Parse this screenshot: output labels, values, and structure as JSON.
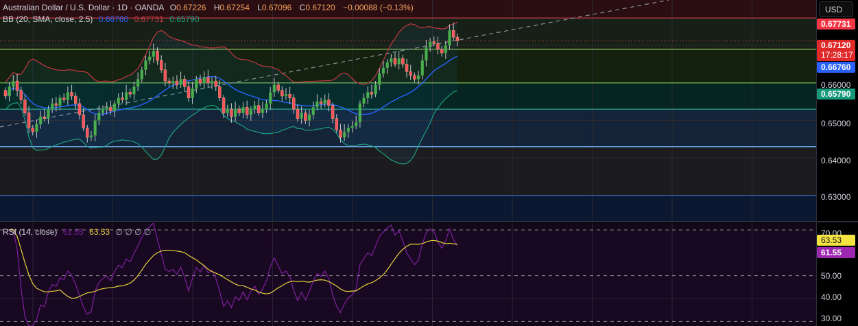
{
  "header": {
    "symbol": "Australian Dollar / U.S. Dollar · 1D · OANDA",
    "open_label": "O",
    "open": "0.67226",
    "high_label": "H",
    "high": "0.67254",
    "low_label": "L",
    "low": "0.67096",
    "close_label": "C",
    "close": "0.67120",
    "change": "−0.00088 (−0.13%)"
  },
  "bb_legend": {
    "label": "BB (20, SMA, close, 2.5)",
    "basis": "0.66760",
    "upper": "0.67731",
    "lower": "0.65790"
  },
  "rsi_legend": {
    "label": "RSI (14, close)",
    "rsi": "61.55",
    "ma": "63.53",
    "extras": "∅ ∅ ∅ ∅"
  },
  "currency_button": "USD",
  "price_axis": {
    "ticks": [
      "0.66000",
      "0.65000",
      "0.64000",
      "0.63000"
    ],
    "tags": {
      "upper": "0.67731",
      "last": "0.67120",
      "countdown": "17:28:17",
      "basis": "0.66760",
      "lower": "0.65790"
    }
  },
  "rsi_axis": {
    "ticks": [
      "70.00",
      "50.00",
      "40.00",
      "30.00"
    ],
    "tags": {
      "ma": "63.53",
      "rsi": "61.55"
    }
  },
  "colors": {
    "up": "#4caf50",
    "down": "#f7525f",
    "bb_basis": "#2962ff",
    "bb_upper": "#c2393f",
    "bb_lower": "#1f9e80",
    "rsi": "#7e1fa0",
    "rsi_ma": "#e8d33a"
  },
  "chart_data": {
    "type": "candlestick",
    "title": "Australian Dollar / U.S. Dollar · 1D · OANDA",
    "ylim": [
      0.6232,
      0.6821
    ],
    "y_ticks": [
      0.63,
      0.64,
      0.65,
      0.66
    ],
    "closes": [
      0.6565,
      0.659,
      0.6605,
      0.658,
      0.6555,
      0.652,
      0.648,
      0.647,
      0.649,
      0.651,
      0.6505,
      0.653,
      0.6545,
      0.654,
      0.656,
      0.6555,
      0.6575,
      0.6565,
      0.6545,
      0.6515,
      0.648,
      0.6455,
      0.646,
      0.65,
      0.652,
      0.653,
      0.6535,
      0.6525,
      0.6545,
      0.656,
      0.6555,
      0.6575,
      0.657,
      0.659,
      0.661,
      0.6635,
      0.666,
      0.667,
      0.6685,
      0.666,
      0.6635,
      0.6605,
      0.66,
      0.6605,
      0.6595,
      0.661,
      0.659,
      0.656,
      0.6585,
      0.661,
      0.66,
      0.6615,
      0.66,
      0.6605,
      0.659,
      0.656,
      0.652,
      0.653,
      0.651,
      0.653,
      0.652,
      0.6535,
      0.6515,
      0.653,
      0.654,
      0.652,
      0.653,
      0.6545,
      0.6575,
      0.6595,
      0.658,
      0.6565,
      0.657,
      0.656,
      0.653,
      0.6505,
      0.652,
      0.65,
      0.6515,
      0.6535,
      0.655,
      0.6545,
      0.6555,
      0.654,
      0.6505,
      0.6475,
      0.6455,
      0.647,
      0.648,
      0.6485,
      0.6495,
      0.6545,
      0.656,
      0.6575,
      0.657,
      0.6595,
      0.6625,
      0.664,
      0.6655,
      0.6665,
      0.665,
      0.6665,
      0.665,
      0.663,
      0.662,
      0.661,
      0.662,
      0.666,
      0.6695,
      0.671,
      0.6705,
      0.669,
      0.668,
      0.67,
      0.674,
      0.6722,
      0.6712
    ],
    "horizontal_levels": [
      {
        "price": 0.67731,
        "color": "#e04050"
      },
      {
        "price": 0.669,
        "color": "#9acd62"
      },
      {
        "price": 0.66,
        "color": "#7ccf5a"
      },
      {
        "price": 0.653,
        "color": "#30b59b"
      },
      {
        "price": 0.643,
        "color": "#6fb7ff"
      },
      {
        "price": 0.63,
        "color": "#3f6fc7"
      }
    ],
    "zones": [
      {
        "from": 0.6821,
        "to": 0.67731,
        "color": "#2a0e12"
      },
      {
        "from": 0.67731,
        "to": 0.669,
        "color": "#172016"
      },
      {
        "from": 0.669,
        "to": 0.66,
        "color": "#14210f"
      },
      {
        "from": 0.66,
        "to": 0.653,
        "color": "#062420"
      },
      {
        "from": 0.653,
        "to": 0.643,
        "color": "#142337"
      },
      {
        "from": 0.643,
        "to": 0.63,
        "color": "#1c1c1e"
      },
      {
        "from": 0.63,
        "to": 0.6232,
        "color": "#0c1832"
      }
    ],
    "rsi": {
      "period": 14,
      "ma_period": 14,
      "ylim": [
        28,
        73
      ],
      "levels": [
        70,
        50,
        30
      ],
      "ticks": [
        70,
        50,
        40,
        30
      ]
    }
  }
}
